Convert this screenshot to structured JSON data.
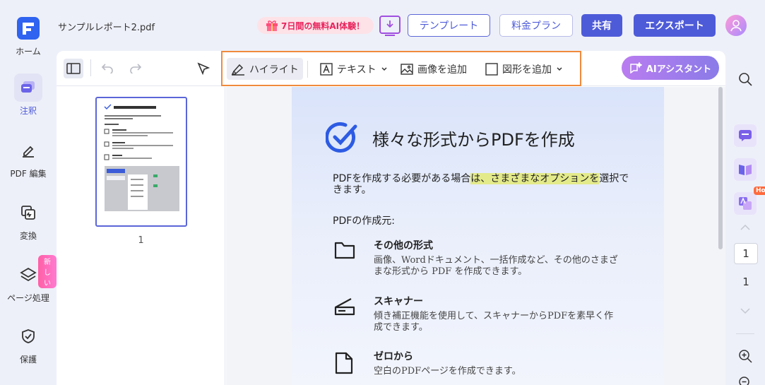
{
  "app": {
    "filename": "サンプルレポート2.pdf",
    "promo_label": "7日間の無料AI体験！",
    "template_label": "テンプレート",
    "plan_label": "料金プラン",
    "share_label": "共有",
    "export_label": "エクスポート"
  },
  "leftnav": {
    "items": [
      {
        "label": "ホーム",
        "icon": "logo-icon"
      },
      {
        "label": "注釈",
        "icon": "annotate-icon",
        "active": true
      },
      {
        "label": "PDF 編集",
        "icon": "edit-icon"
      },
      {
        "label": "変換",
        "icon": "convert-icon"
      },
      {
        "label": "ページ処理",
        "icon": "layers-icon",
        "badge": "新しい"
      },
      {
        "label": "保護",
        "icon": "shield-icon"
      }
    ]
  },
  "toolbar": {
    "highlight_label": "ハイライト",
    "text_label": "テキスト",
    "image_label": "画像を追加",
    "shape_label": "図形を追加",
    "ai_label": "AIアシスタント"
  },
  "thumbnail": {
    "page_number": "1"
  },
  "page": {
    "title": "様々な形式からPDFを作成",
    "intro_before": "PDFを作成する必要がある場合",
    "intro_highlight": "は、さまざまなオプションを",
    "intro_after": "選択できます。",
    "subtitle": "PDFの作成元:",
    "items": [
      {
        "heading": "その他の形式",
        "desc": "画像、Wordドキュメント、一括作成など、その他のさまざまな形式から PDF を作成できます。",
        "icon": "folder-icon"
      },
      {
        "heading": "スキャナー",
        "desc": "傾き補正機能を使用して、スキャナーからPDFを素早く作成できます。",
        "icon": "scanner-icon"
      },
      {
        "heading": "ゼロから",
        "desc": "空白のPDFページを作成できます。",
        "icon": "blank-page-icon"
      }
    ]
  },
  "rightrail": {
    "hot_badge": "Hot",
    "current_page": "1",
    "total_pages": "1"
  },
  "colors": {
    "accent": "#4e5bd8",
    "highlight": "#e3ea8a",
    "tool_border": "#f08a3c"
  }
}
